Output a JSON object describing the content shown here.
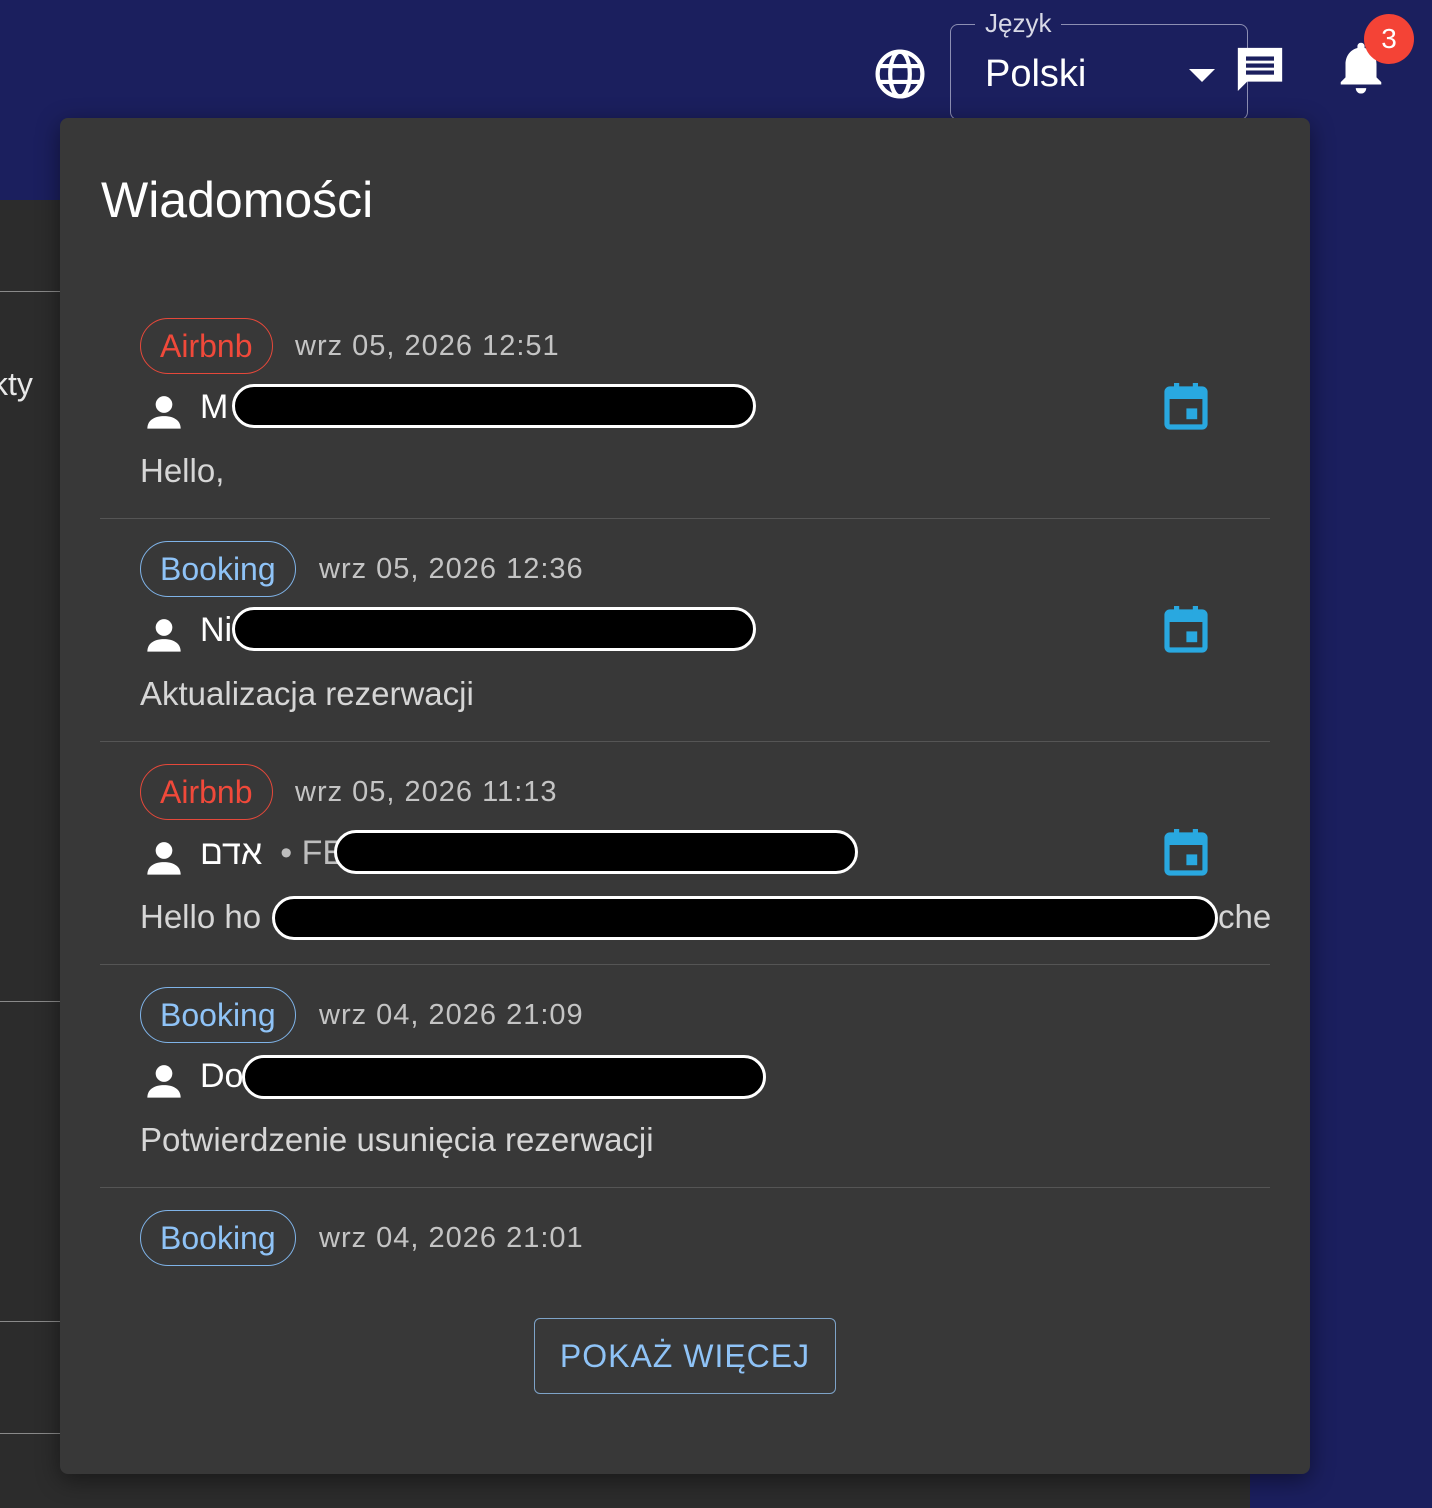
{
  "header": {
    "language_label": "Język",
    "language_value": "Polski",
    "notification_count": "3",
    "icons": {
      "globe": "globe-icon",
      "chat": "chat-icon",
      "bell": "bell-icon",
      "caret": "chevron-down-icon"
    }
  },
  "background": {
    "partial_text": "kty"
  },
  "popover": {
    "title": "Wiadomości",
    "show_more_label": "POKAŻ WIĘCEJ",
    "messages": [
      {
        "source": "Airbnb",
        "date": "wrz 05, 2026 12:51",
        "sender_visible": "M",
        "snippet": "Hello,",
        "icon": "calendar-icon"
      },
      {
        "source": "Booking",
        "date": "wrz 05, 2026 12:36",
        "sender_visible": "Ni",
        "snippet": "Aktualizacja rezerwacji",
        "icon": "calendar-icon"
      },
      {
        "source": "Airbnb",
        "date": "wrz 05, 2026 11:13",
        "sender_visible": "אדם",
        "sender_extra": "• FE",
        "snippet_start": "Hello ho",
        "snippet_end": "che",
        "icon": "calendar-icon"
      },
      {
        "source": "Booking",
        "date": "wrz 04, 2026 21:09",
        "sender_visible": "Do",
        "snippet": "Potwierdzenie usunięcia rezerwacji"
      },
      {
        "source": "Booking",
        "date": "wrz 04, 2026 21:01",
        "icon": "calendar-icon"
      }
    ]
  },
  "colors": {
    "header_bg": "#1b1f5e",
    "popover_bg": "#383838",
    "airbnb": "#f0493a",
    "booking": "#8fc3f7",
    "calendar": "#29a8e0",
    "badge": "#f44336"
  }
}
